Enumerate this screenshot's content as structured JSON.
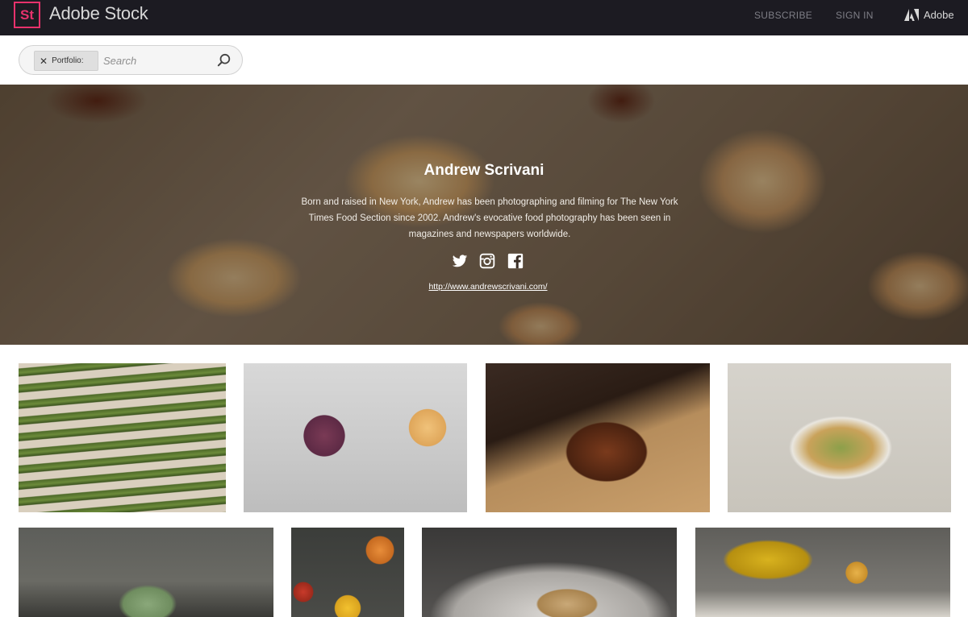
{
  "app": {
    "logo_text": "St",
    "brand": "Adobe Stock",
    "nav": {
      "subscribe": "SUBSCRIBE",
      "sign_in": "SIGN IN"
    },
    "adobe_label": "Adobe",
    "adobe_icon": "adobe-logo-icon"
  },
  "search": {
    "chip_label": "Portfolio:",
    "chip_remove_icon": "close-icon",
    "placeholder": "Search",
    "value": "",
    "icon": "search-icon"
  },
  "hero": {
    "name": "Andrew Scrivani",
    "bio": "Born and raised in New York, Andrew has been photographing and filming for The New York Times Food Section since 2002. Andrew's evocative food photography has been seen in magazines and newspapers worldwide.",
    "social": [
      "twitter-icon",
      "instagram-icon",
      "facebook-icon"
    ],
    "link": "http://www.andrewscrivani.com/"
  },
  "gallery": {
    "rows": [
      [
        "asparagus",
        "roses",
        "sliced-meat",
        "pasta-plate"
      ],
      [
        "green-drink",
        "fruit",
        "flour-cookie",
        "olive-oil"
      ]
    ]
  },
  "colors": {
    "topbar_bg": "#1c1b22",
    "logo_accent": "#e8326c",
    "nav_text": "#7e7e86"
  }
}
